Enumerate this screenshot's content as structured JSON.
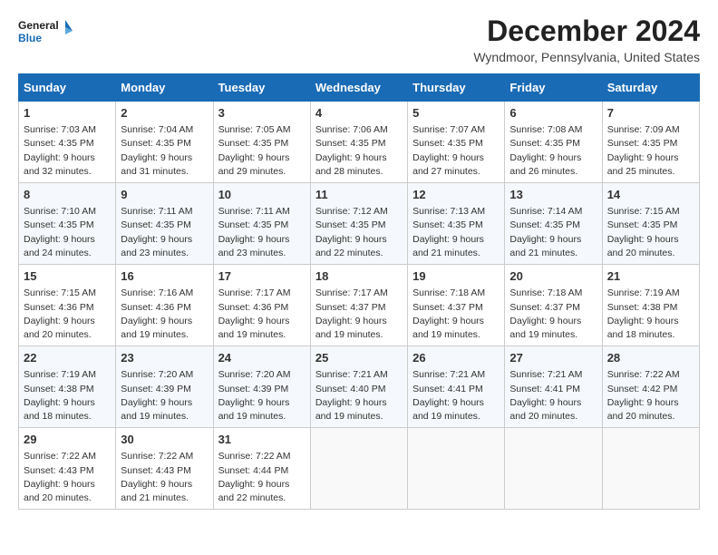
{
  "logo": {
    "line1": "General",
    "line2": "Blue"
  },
  "title": "December 2024",
  "subtitle": "Wyndmoor, Pennsylvania, United States",
  "days_of_week": [
    "Sunday",
    "Monday",
    "Tuesday",
    "Wednesday",
    "Thursday",
    "Friday",
    "Saturday"
  ],
  "weeks": [
    [
      {
        "day": 1,
        "sunrise": "7:03 AM",
        "sunset": "4:35 PM",
        "daylight": "9 hours and 32 minutes"
      },
      {
        "day": 2,
        "sunrise": "7:04 AM",
        "sunset": "4:35 PM",
        "daylight": "9 hours and 31 minutes"
      },
      {
        "day": 3,
        "sunrise": "7:05 AM",
        "sunset": "4:35 PM",
        "daylight": "9 hours and 29 minutes"
      },
      {
        "day": 4,
        "sunrise": "7:06 AM",
        "sunset": "4:35 PM",
        "daylight": "9 hours and 28 minutes"
      },
      {
        "day": 5,
        "sunrise": "7:07 AM",
        "sunset": "4:35 PM",
        "daylight": "9 hours and 27 minutes"
      },
      {
        "day": 6,
        "sunrise": "7:08 AM",
        "sunset": "4:35 PM",
        "daylight": "9 hours and 26 minutes"
      },
      {
        "day": 7,
        "sunrise": "7:09 AM",
        "sunset": "4:35 PM",
        "daylight": "9 hours and 25 minutes"
      }
    ],
    [
      {
        "day": 8,
        "sunrise": "7:10 AM",
        "sunset": "4:35 PM",
        "daylight": "9 hours and 24 minutes"
      },
      {
        "day": 9,
        "sunrise": "7:11 AM",
        "sunset": "4:35 PM",
        "daylight": "9 hours and 23 minutes"
      },
      {
        "day": 10,
        "sunrise": "7:11 AM",
        "sunset": "4:35 PM",
        "daylight": "9 hours and 23 minutes"
      },
      {
        "day": 11,
        "sunrise": "7:12 AM",
        "sunset": "4:35 PM",
        "daylight": "9 hours and 22 minutes"
      },
      {
        "day": 12,
        "sunrise": "7:13 AM",
        "sunset": "4:35 PM",
        "daylight": "9 hours and 21 minutes"
      },
      {
        "day": 13,
        "sunrise": "7:14 AM",
        "sunset": "4:35 PM",
        "daylight": "9 hours and 21 minutes"
      },
      {
        "day": 14,
        "sunrise": "7:15 AM",
        "sunset": "4:35 PM",
        "daylight": "9 hours and 20 minutes"
      }
    ],
    [
      {
        "day": 15,
        "sunrise": "7:15 AM",
        "sunset": "4:36 PM",
        "daylight": "9 hours and 20 minutes"
      },
      {
        "day": 16,
        "sunrise": "7:16 AM",
        "sunset": "4:36 PM",
        "daylight": "9 hours and 19 minutes"
      },
      {
        "day": 17,
        "sunrise": "7:17 AM",
        "sunset": "4:36 PM",
        "daylight": "9 hours and 19 minutes"
      },
      {
        "day": 18,
        "sunrise": "7:17 AM",
        "sunset": "4:37 PM",
        "daylight": "9 hours and 19 minutes"
      },
      {
        "day": 19,
        "sunrise": "7:18 AM",
        "sunset": "4:37 PM",
        "daylight": "9 hours and 19 minutes"
      },
      {
        "day": 20,
        "sunrise": "7:18 AM",
        "sunset": "4:37 PM",
        "daylight": "9 hours and 19 minutes"
      },
      {
        "day": 21,
        "sunrise": "7:19 AM",
        "sunset": "4:38 PM",
        "daylight": "9 hours and 18 minutes"
      }
    ],
    [
      {
        "day": 22,
        "sunrise": "7:19 AM",
        "sunset": "4:38 PM",
        "daylight": "9 hours and 18 minutes"
      },
      {
        "day": 23,
        "sunrise": "7:20 AM",
        "sunset": "4:39 PM",
        "daylight": "9 hours and 19 minutes"
      },
      {
        "day": 24,
        "sunrise": "7:20 AM",
        "sunset": "4:39 PM",
        "daylight": "9 hours and 19 minutes"
      },
      {
        "day": 25,
        "sunrise": "7:21 AM",
        "sunset": "4:40 PM",
        "daylight": "9 hours and 19 minutes"
      },
      {
        "day": 26,
        "sunrise": "7:21 AM",
        "sunset": "4:41 PM",
        "daylight": "9 hours and 19 minutes"
      },
      {
        "day": 27,
        "sunrise": "7:21 AM",
        "sunset": "4:41 PM",
        "daylight": "9 hours and 20 minutes"
      },
      {
        "day": 28,
        "sunrise": "7:22 AM",
        "sunset": "4:42 PM",
        "daylight": "9 hours and 20 minutes"
      }
    ],
    [
      {
        "day": 29,
        "sunrise": "7:22 AM",
        "sunset": "4:43 PM",
        "daylight": "9 hours and 20 minutes"
      },
      {
        "day": 30,
        "sunrise": "7:22 AM",
        "sunset": "4:43 PM",
        "daylight": "9 hours and 21 minutes"
      },
      {
        "day": 31,
        "sunrise": "7:22 AM",
        "sunset": "4:44 PM",
        "daylight": "9 hours and 22 minutes"
      },
      null,
      null,
      null,
      null
    ]
  ],
  "labels": {
    "sunrise": "Sunrise:",
    "sunset": "Sunset:",
    "daylight": "Daylight:"
  }
}
